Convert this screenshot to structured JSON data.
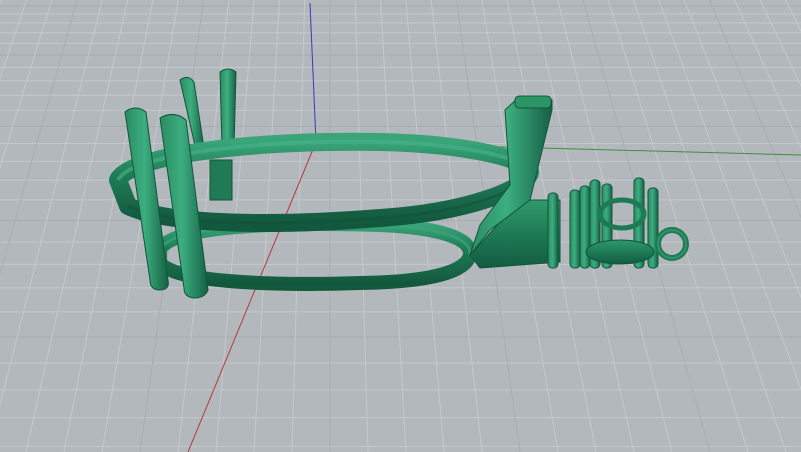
{
  "viewport": {
    "view_type": "perspective",
    "grid_visible": true,
    "axes_visible": true
  },
  "colors": {
    "background": "#b3b8bd",
    "grid_minor": "#c5c9cd",
    "grid_major": "#a8adb2",
    "axis_x": "#b83a34",
    "axis_y": "#3f8f47",
    "axis_z": "#3a3ab8",
    "model": "#1e7a55",
    "model_highlight": "#3aa57a",
    "model_shadow": "#11553a"
  },
  "model": {
    "description_icon": "ring-setting-model-icon"
  }
}
